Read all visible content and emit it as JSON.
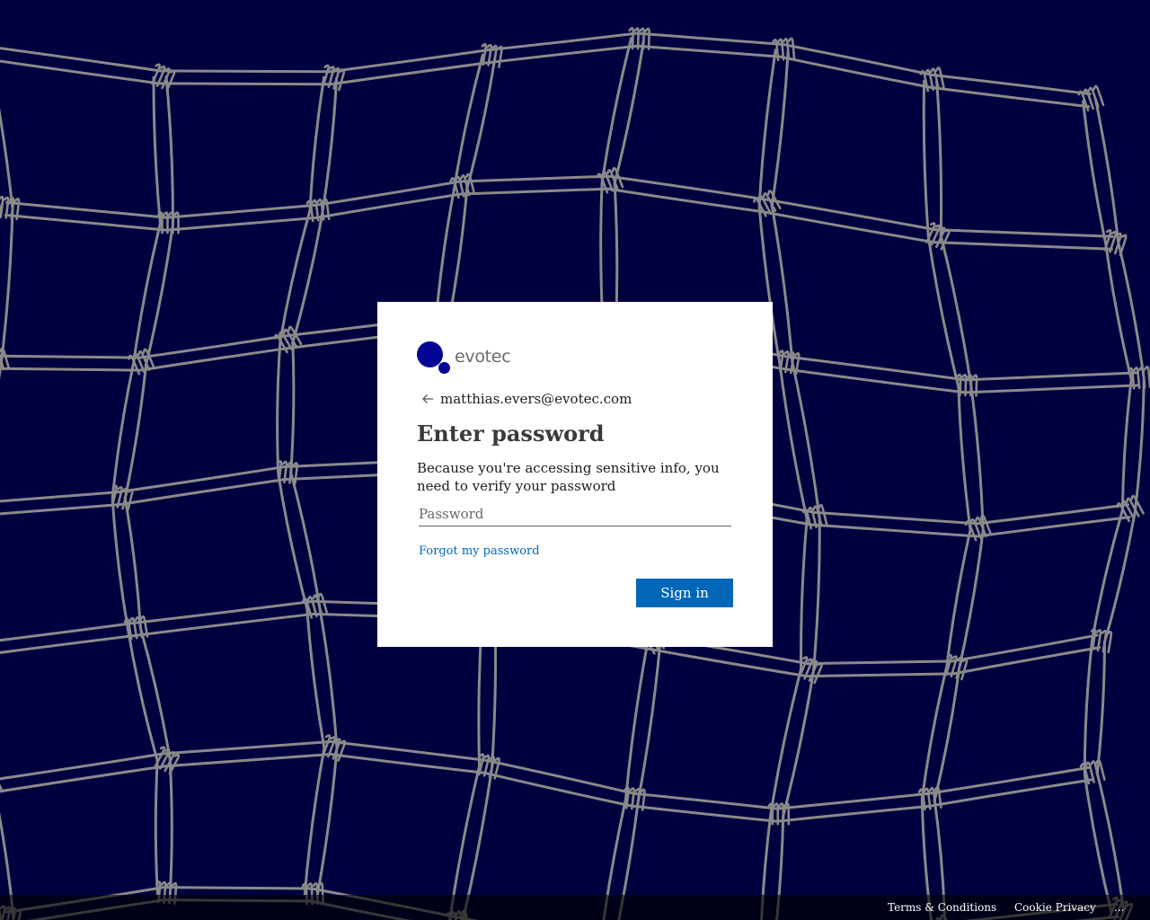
{
  "brand": {
    "name": "evotec",
    "color": "#050595"
  },
  "identity": {
    "email": "matthias.evers@evotec.com"
  },
  "title": "Enter password",
  "description": "Because you're accessing sensitive info, you need to verify your password",
  "password_field": {
    "placeholder": "Password",
    "value": ""
  },
  "forgot_link": "Forgot my password",
  "signin_button": "Sign in",
  "footer": {
    "terms": "Terms & Conditions",
    "privacy": "Cookie Privacy",
    "more": "..."
  },
  "colors": {
    "background": "#00003f",
    "net_lines": "#8a8a8a",
    "accent": "#0067b8"
  },
  "icons": {
    "back": "back-arrow-icon"
  }
}
